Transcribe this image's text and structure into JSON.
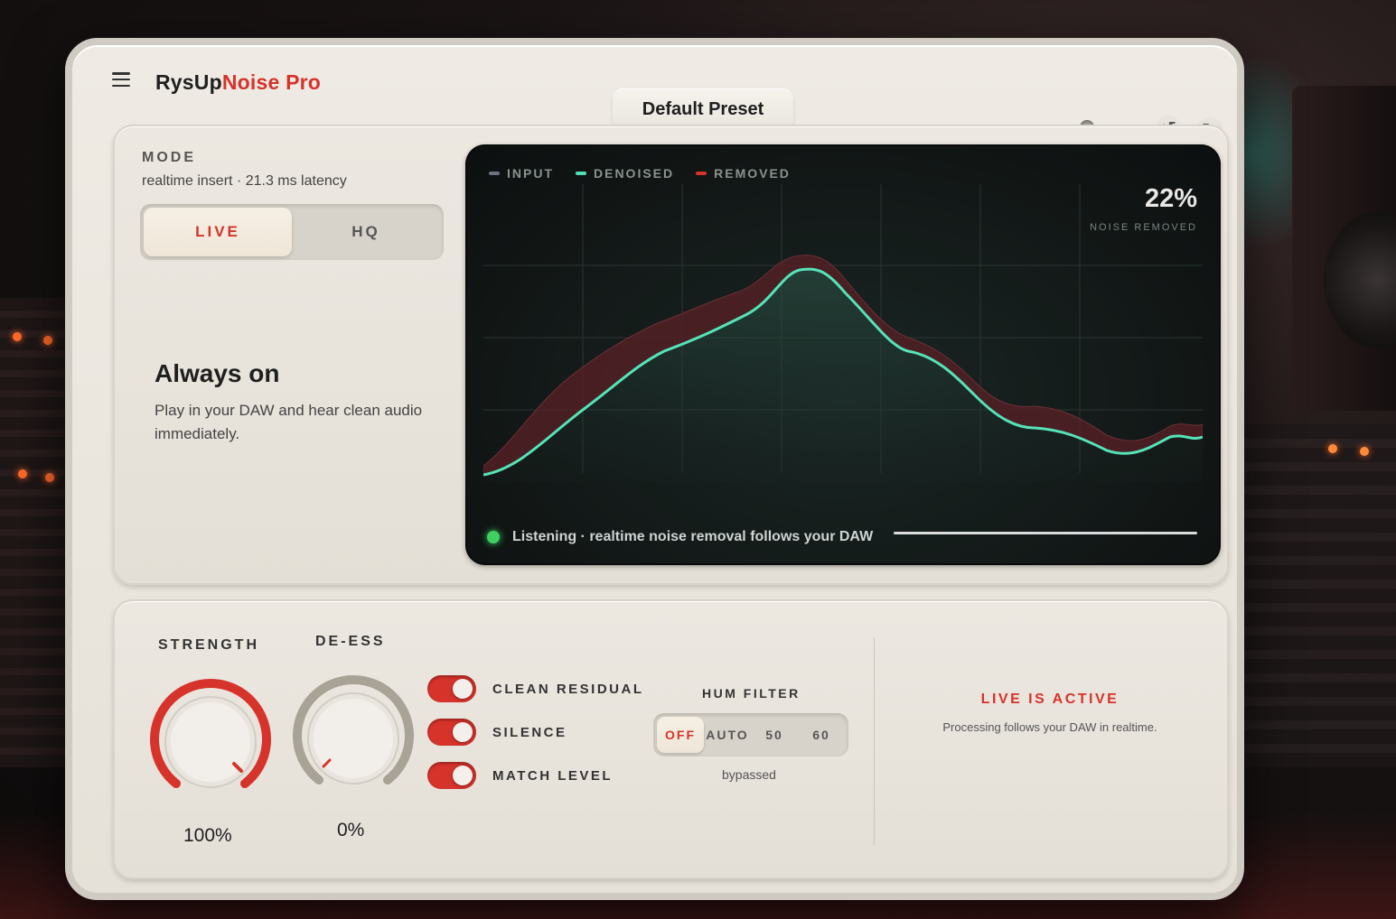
{
  "app": {
    "brand_part1": "RysUp",
    "brand_part2": "Noise Pro",
    "preset": "Default Preset",
    "accent_color": "#d6332b"
  },
  "mode": {
    "label": "MODE",
    "subtitle": "realtime insert · 21.3 ms latency",
    "options": [
      "LIVE",
      "HQ"
    ],
    "selected": "LIVE",
    "heading": "Always on",
    "description": "Play in your DAW and hear clean audio immediately."
  },
  "graph": {
    "legend": [
      {
        "label": "INPUT",
        "color": "#6b7480"
      },
      {
        "label": "DENOISED",
        "color": "#4fe0b8"
      },
      {
        "label": "REMOVED",
        "color": "#d6332b"
      }
    ],
    "noise_removed_value": "22%",
    "noise_removed_label": "NOISE REMOVED",
    "status": "Listening · realtime noise removal follows your DAW"
  },
  "controls": {
    "strength": {
      "label": "STRENGTH",
      "value": "100%",
      "level": 1.0
    },
    "deess": {
      "label": "DE-ESS",
      "value": "0%",
      "level": 0.0
    },
    "toggles": [
      {
        "label": "CLEAN RESIDUAL",
        "on": true
      },
      {
        "label": "SILENCE",
        "on": true
      },
      {
        "label": "MATCH LEVEL",
        "on": true
      }
    ],
    "hum_filter": {
      "label": "HUM FILTER",
      "options": [
        "OFF",
        "AUTO",
        "50",
        "60"
      ],
      "selected": "OFF",
      "status": "bypassed"
    },
    "live_status": {
      "title": "LIVE IS ACTIVE",
      "description": "Processing follows your DAW in realtime."
    }
  },
  "icons": {
    "menu": "menu-icon",
    "theme": "sun-icon",
    "undo": "undo-icon",
    "redo": "redo-icon"
  }
}
